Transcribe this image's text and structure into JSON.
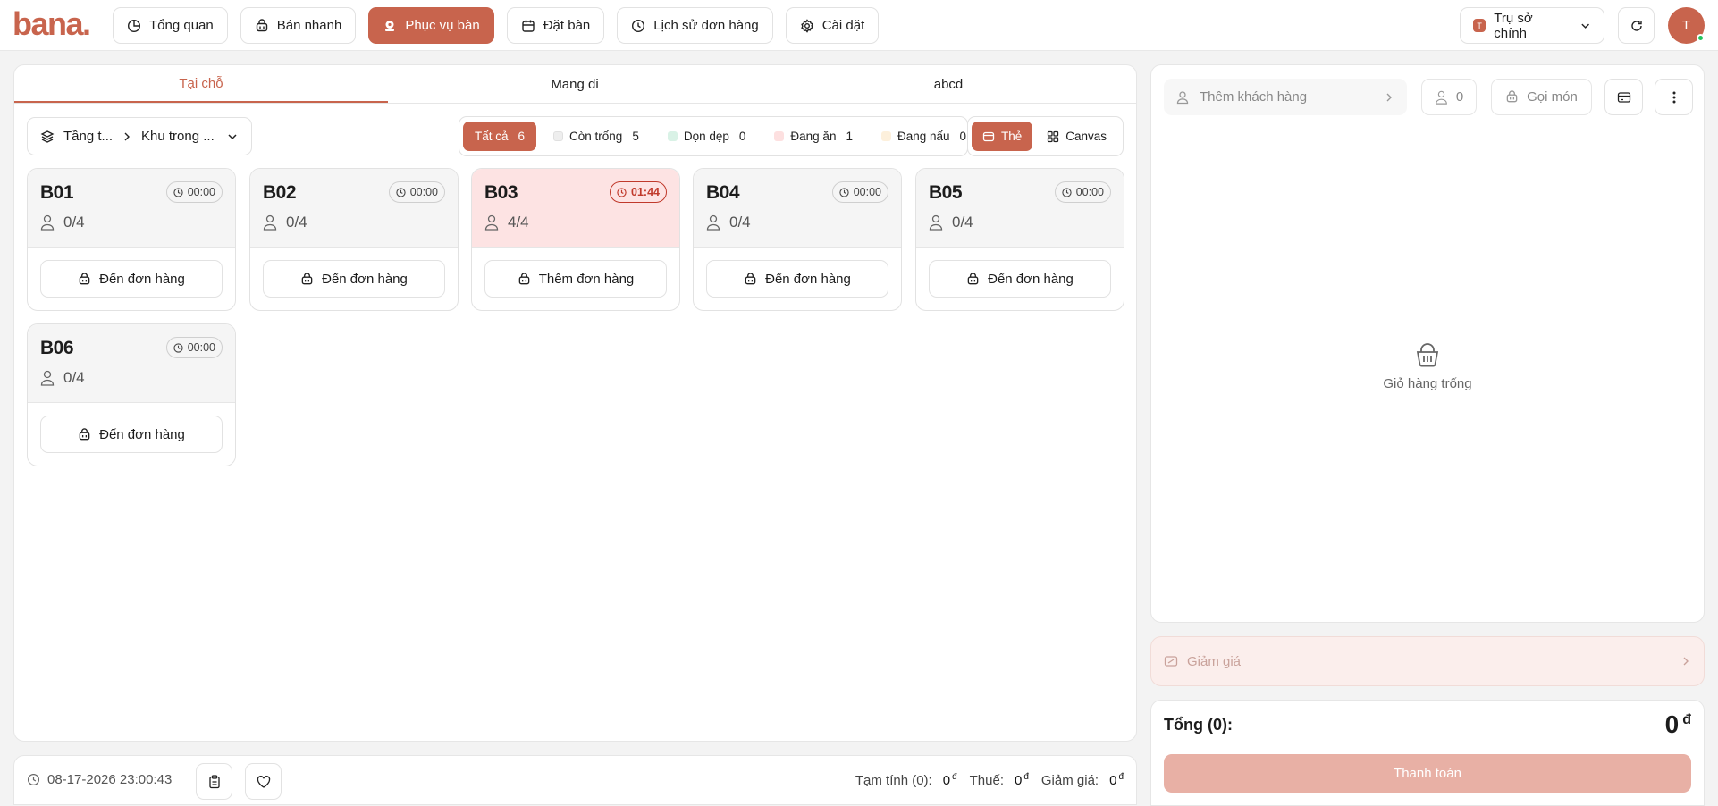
{
  "app": {
    "logo_text": "bana",
    "logo_dot": "."
  },
  "nav": [
    {
      "label": "Tổng quan",
      "icon": "pie-chart-icon",
      "active": false
    },
    {
      "label": "Bán nhanh",
      "icon": "basket-icon",
      "active": false
    },
    {
      "label": "Phục vụ bàn",
      "icon": "waiter-icon",
      "active": true
    },
    {
      "label": "Đặt bàn",
      "icon": "calendar-icon",
      "active": false
    },
    {
      "label": "Lịch sử đơn hàng",
      "icon": "history-icon",
      "active": false
    },
    {
      "label": "Cài đặt",
      "icon": "gear-icon",
      "active": false
    }
  ],
  "branch": {
    "badge": "T",
    "label": "Trụ sở chính"
  },
  "user": {
    "initial": "T"
  },
  "tabs": [
    "Tại chỗ",
    "Mang đi",
    "abcd"
  ],
  "area": {
    "floor": "Tầng t...",
    "zone": "Khu trong ..."
  },
  "filters": [
    {
      "label": "Tất cả",
      "count": "6",
      "swatch": ""
    },
    {
      "label": "Còn trống",
      "count": "5",
      "swatch": "#eeeeee"
    },
    {
      "label": "Dọn dẹp",
      "count": "0",
      "swatch": "#d9f2e6"
    },
    {
      "label": "Đang ăn",
      "count": "1",
      "swatch": "#fde0e0"
    },
    {
      "label": "Đang nấu",
      "count": "0",
      "swatch": "#fdf0dc"
    }
  ],
  "views": {
    "card": "Thẻ",
    "canvas": "Canvas"
  },
  "tables": [
    {
      "name": "B01",
      "timer": "00:00",
      "guests": "0/4",
      "action": "Đến đơn hàng",
      "busy": false
    },
    {
      "name": "B02",
      "timer": "00:00",
      "guests": "0/4",
      "action": "Đến đơn hàng",
      "busy": false
    },
    {
      "name": "B03",
      "timer": "01:44",
      "guests": "4/4",
      "action": "Thêm đơn hàng",
      "busy": true
    },
    {
      "name": "B04",
      "timer": "00:00",
      "guests": "0/4",
      "action": "Đến đơn hàng",
      "busy": false
    },
    {
      "name": "B05",
      "timer": "00:00",
      "guests": "0/4",
      "action": "Đến đơn hàng",
      "busy": false
    },
    {
      "name": "B06",
      "timer": "00:00",
      "guests": "0/4",
      "action": "Đến đơn hàng",
      "busy": false
    }
  ],
  "footer": {
    "datetime": "08-17-2026 23:00:43",
    "subtotal_label": "Tạm tính (0):",
    "subtotal": "0",
    "tax_label": "Thuế:",
    "tax": "0",
    "discount_label": "Giảm giá:",
    "discount": "0",
    "currency": "đ"
  },
  "cart": {
    "add_customer": "Thêm khách hàng",
    "guest_count": "0",
    "order_label": "Gọi món",
    "empty_text": "Giỏ hàng trống",
    "discount_label": "Giảm giá",
    "total_label": "Tổng (0):",
    "total_value": "0",
    "currency": "đ",
    "pay_label": "Thanh toán"
  },
  "colors": {
    "accent": "#c8644d",
    "busy_bg": "#fde3e3",
    "busy_text": "#c0392b"
  }
}
